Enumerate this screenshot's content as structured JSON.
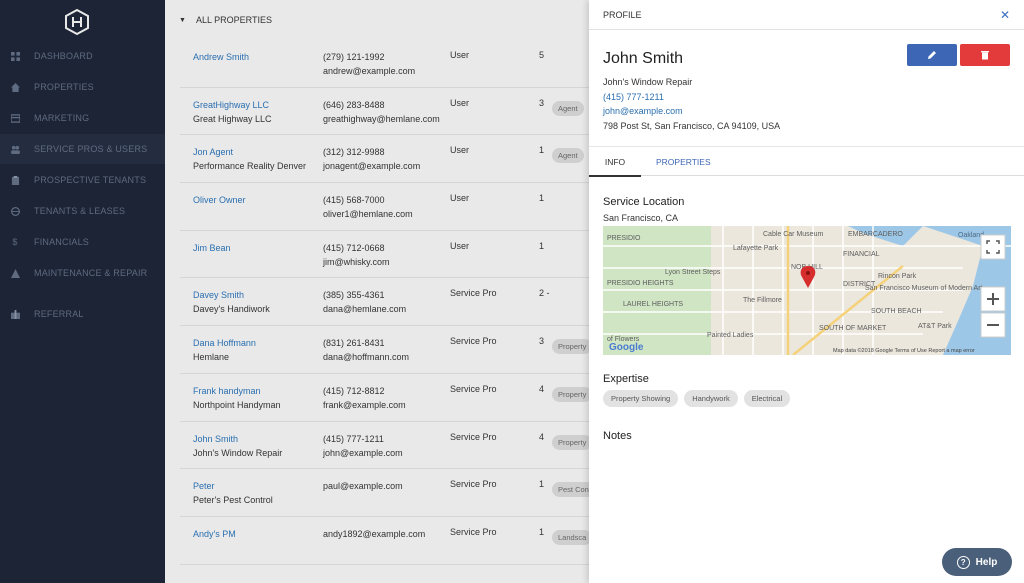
{
  "sidebar": {
    "items": [
      {
        "label": "Dashboard",
        "icon": "dashboard-icon"
      },
      {
        "label": "Properties",
        "icon": "home-icon"
      },
      {
        "label": "Marketing",
        "icon": "marketing-icon"
      },
      {
        "label": "Service Pros & Users",
        "icon": "users-icon"
      },
      {
        "label": "Prospective Tenants",
        "icon": "clipboard-icon"
      },
      {
        "label": "Tenants & Leases",
        "icon": "globe-icon"
      },
      {
        "label": "Financials",
        "icon": "dollar-icon"
      },
      {
        "label": "Maintenance & Repair",
        "icon": "warning-icon"
      },
      {
        "label": "Referral",
        "icon": "gift-icon"
      }
    ]
  },
  "list": {
    "header": "ALL PROPERTIES",
    "rows": [
      {
        "name": "Andrew Smith",
        "company": "",
        "phone": "(279) 121-1992",
        "email": "andrew@example.com",
        "role": "User",
        "count": "5",
        "tag": ""
      },
      {
        "name": "GreatHighway LLC",
        "company": "Great Highway LLC",
        "phone": "(646) 283-8488",
        "email": "greathighway@hemlane.com",
        "role": "User",
        "count": "3",
        "tag": "Agent"
      },
      {
        "name": "Jon Agent",
        "company": "Performance Reality Denver",
        "phone": "(312) 312-9988",
        "email": "jonagent@example.com",
        "role": "User",
        "count": "1",
        "tag": "Agent"
      },
      {
        "name": "Oliver Owner",
        "company": "",
        "phone": "(415) 568-7000",
        "email": "oliver1@hemlane.com",
        "role": "User",
        "count": "1",
        "tag": ""
      },
      {
        "name": "Jim Bean",
        "company": "",
        "phone": "(415) 712-0668",
        "email": "jim@whisky.com",
        "role": "User",
        "count": "1",
        "tag": ""
      },
      {
        "name": "Davey Smith",
        "company": "Davey's Handiwork",
        "phone": "(385) 355-4361",
        "email": "dana@hemlane.com",
        "role": "Service Pro",
        "count": "2 -",
        "tag": ""
      },
      {
        "name": "Dana Hoffmann",
        "company": "Hemlane",
        "phone": "(831) 261-8431",
        "email": "dana@hoffmann.com",
        "role": "Service Pro",
        "count": "3",
        "tag": "Property"
      },
      {
        "name": "Frank handyman",
        "company": "Northpoint Handyman",
        "phone": "(415) 712-8812",
        "email": "frank@example.com",
        "role": "Service Pro",
        "count": "4",
        "tag": "Property"
      },
      {
        "name": "John Smith",
        "company": "John's Window Repair",
        "phone": "(415) 777-1211",
        "email": "john@example.com",
        "role": "Service Pro",
        "count": "4",
        "tag": "Property"
      },
      {
        "name": "Peter",
        "company": "Peter's Pest Control",
        "phone": "",
        "email": "paul@example.com",
        "role": "Service Pro",
        "count": "1",
        "tag": "Pest Con"
      },
      {
        "name": "Andy's PM",
        "company": "",
        "phone": "",
        "email": "andy1892@example.com",
        "role": "Service Pro",
        "count": "1",
        "tag": "Landsca"
      }
    ]
  },
  "profile": {
    "header": "PROFILE",
    "name": "John Smith",
    "company": "John's Window Repair",
    "phone": "(415) 777-1211",
    "email": "john@example.com",
    "address": "798 Post St, San Francisco, CA 94109, USA",
    "tabs": {
      "info": "Info",
      "properties": "Properties"
    },
    "service_location_title": "Service Location",
    "service_location": "San Francisco, CA",
    "map_labels": {
      "cable_car": "Cable Car Museum",
      "embarcadero": "EMBARCADERO",
      "presidio": "PRESIDIO",
      "lafayette": "Lafayette Park",
      "financial": "FINANCIAL",
      "district": "DISTRICT",
      "lyon_steps": "Lyon Street Steps",
      "presidio_heights": "PRESIDIO HEIGHTS",
      "laurel_heights": "LAUREL HEIGHTS",
      "fillmore": "The Fillmore",
      "nob_hill": "NOB HILL",
      "rincon": "Rincon Park",
      "sfmoma": "San Francisco Museum of Modern Art",
      "south_beach": "SOUTH BEACH",
      "att": "AT&T Park",
      "painted": "Painted Ladies",
      "south_market": "SOUTH OF MARKET",
      "flowers": "of Flowers",
      "oakland": "Oakland",
      "google": "Google",
      "attribution": "Map data ©2018 Google   Terms of Use   Report a map error"
    },
    "expertise_title": "Expertise",
    "expertise": [
      "Property Showing",
      "Handywork",
      "Electrical"
    ],
    "notes_title": "Notes"
  },
  "help": {
    "label": "Help"
  },
  "colors": {
    "sidebar_bg": "#1c2435",
    "edit_btn": "#3d67b5",
    "delete_btn": "#e33b3b",
    "link": "#2a6fb0",
    "pin": "#d62d2d"
  }
}
